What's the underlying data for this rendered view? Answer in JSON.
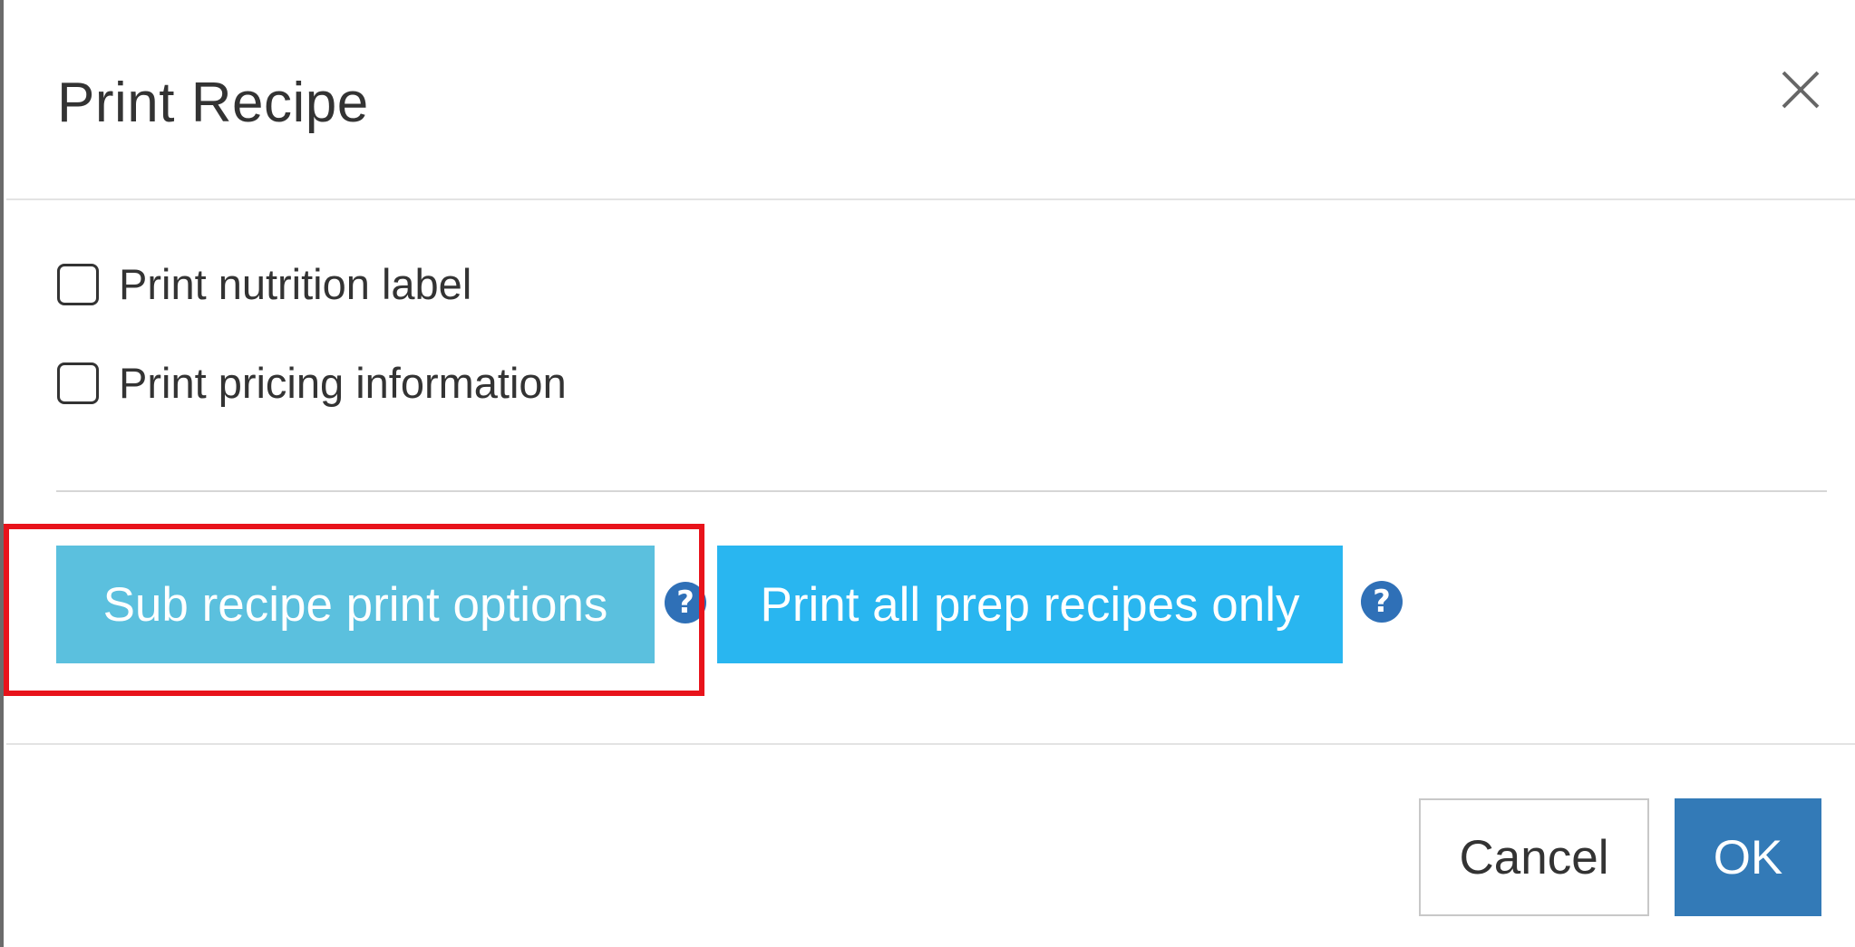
{
  "dialog": {
    "title": "Print Recipe",
    "close_icon": "close-icon"
  },
  "options": [
    {
      "label": "Print nutrition label",
      "checked": false
    },
    {
      "label": "Print pricing information",
      "checked": false
    }
  ],
  "actions": {
    "sub_recipe_label": "Sub recipe print options",
    "prep_recipes_label": "Print all prep recipes only",
    "help_icon": "question-circle-icon",
    "help_glyph": "?"
  },
  "footer": {
    "cancel_label": "Cancel",
    "ok_label": "OK"
  },
  "colors": {
    "sub_recipe_button": "#5bc0de",
    "prep_button": "#29b6f0",
    "ok_button": "#337ab7",
    "help_icon": "#2f70b7",
    "highlight": "#e8131b"
  }
}
